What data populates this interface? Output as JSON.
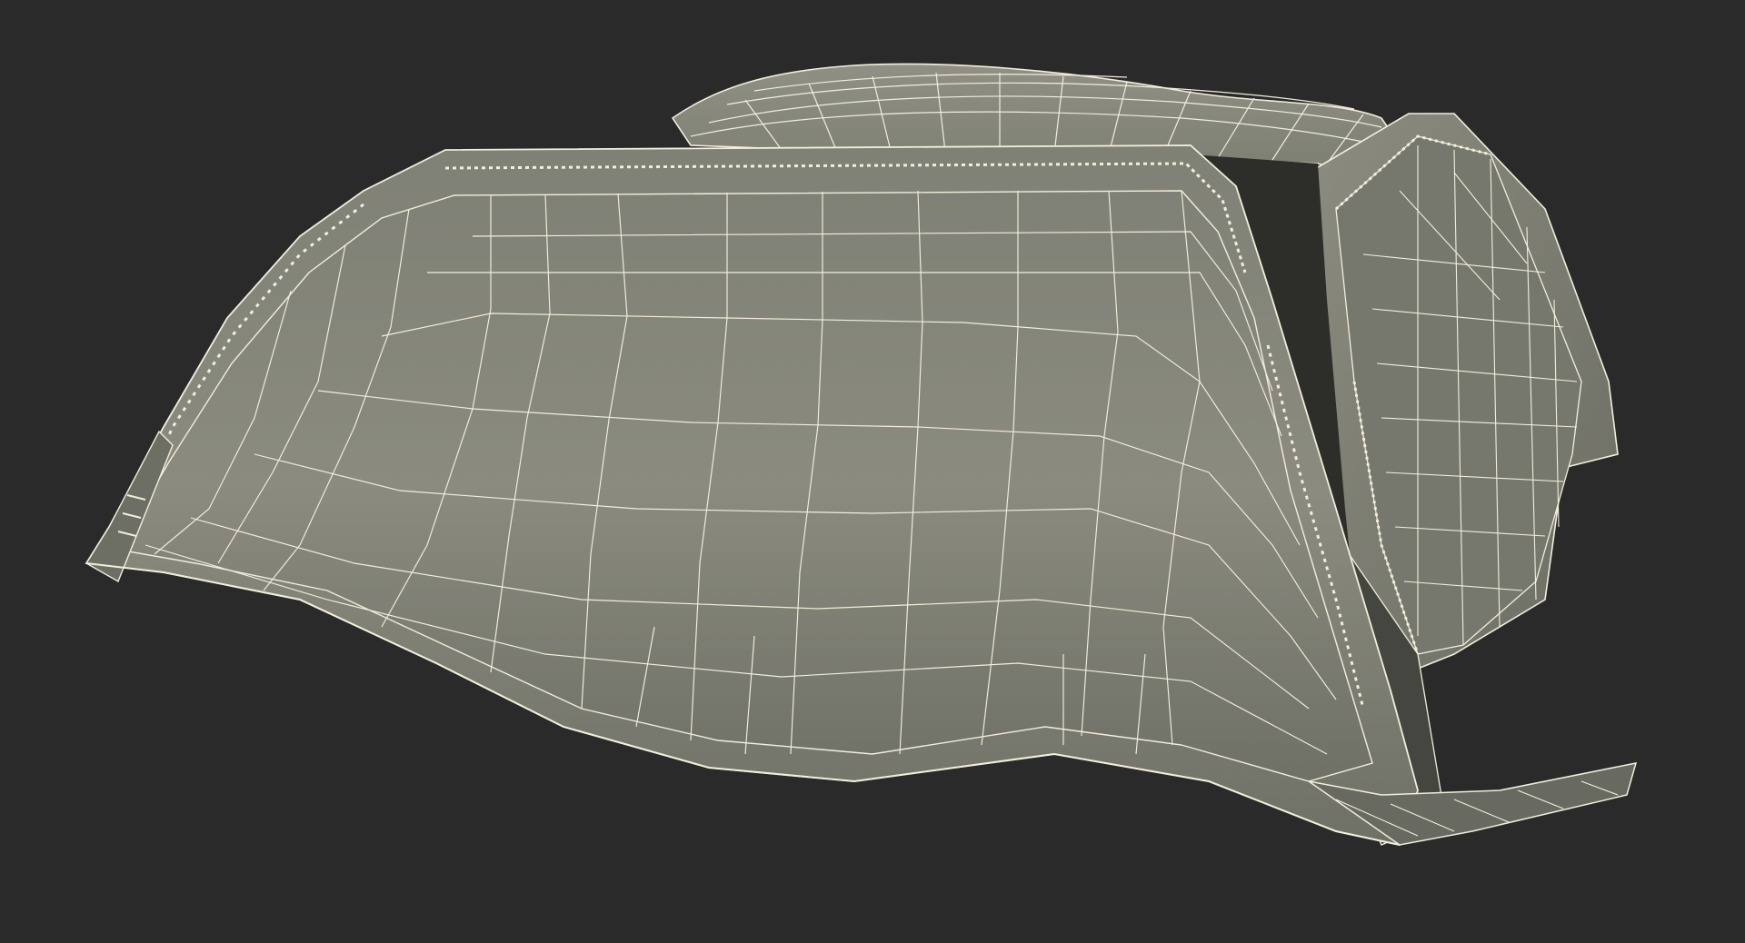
{
  "scene": {
    "subject": "wireframe-3d-model",
    "colors": {
      "background": "#2a2a2a",
      "surface_light": "#8d8d80",
      "surface_mid": "#7a7a6e",
      "surface_dark": "#55564c",
      "shadow": "#151515",
      "wire": "#f2eedc"
    }
  }
}
